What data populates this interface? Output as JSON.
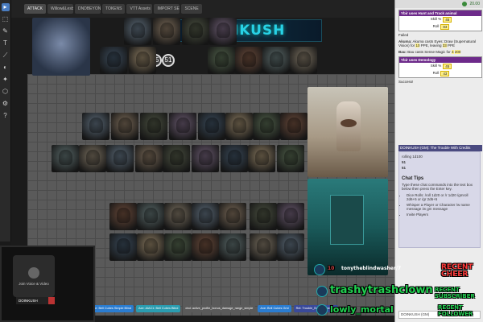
{
  "tabs": [
    "ATTACK",
    "Willow&Lesbians Folder",
    "DNDBEYOND",
    "TOKENS",
    "VTT Assets",
    "IMPORT SETTING",
    "SCENE"
  ],
  "logo_text": "DINKUSH",
  "toolbar_icons": [
    "pointer-icon",
    "select-icon",
    "pen-icon",
    "text-icon",
    "ruler-icon",
    "fog-icon",
    "light-icon",
    "dice-icon",
    "settings-icon",
    "help-icon"
  ],
  "sidebar_top": {
    "status": "20.00"
  },
  "chat": {
    "msg1_header": "Ybir uses Hunt and Track animal",
    "roll1_label": "Skill %",
    "roll1_value": "45",
    "roll1_rolled_label": "Roll",
    "roll1_rolled": "83",
    "roll1_result": "Failed",
    "msg2_name": "Akuma:",
    "msg2_text": "Akuma casts Eyes: Draw (Supernatural Vision) for",
    "msg2_ppe": "10",
    "msg2_ppe_label": "PPE, leaving",
    "msg2_left": "33",
    "msg2_left_label": "PPE",
    "msg3_name": "Bau:",
    "msg3_text": "Bau casts Sense Magic for",
    "msg3_ppe": "4",
    "msg3_left": "200",
    "msg3_header": "Ybir uses Demology",
    "roll2_label": "Skill %",
    "roll2_value": "45",
    "roll2_rolled_label": "Roll",
    "roll2_rolled": "43",
    "roll2_result": "Success!",
    "dark_line": "DOINKUSH (GM): The Trouble With Credits",
    "roll3_label": "rolling 1d100",
    "roll3_value": "51",
    "roll3_total": "51"
  },
  "chat_tips": {
    "title": "Chat Tips",
    "intro": "Type these chat commands into the text box below then press the Enter key.",
    "items": [
      "Dice Rolls: /roll 1d20 or /r 1d20  /gmroll 2d6+5 or /gr 2d6+5",
      "Whisper a Player or Character /w name message  /w gm message",
      "Invite Players"
    ]
  },
  "chat_input": {
    "as_label": "DOINKUSH (GM)"
  },
  "webcam": {
    "join_text": "Join Voice & Video",
    "handle": "DOINKUSH"
  },
  "macros": [
    {
      "label": "Initiative-roll-to-tracker",
      "color": "#c04050"
    },
    {
      "label": "Zug: Sword Of Blade",
      "color": "#8a3aa8"
    },
    {
      "label": "Axe: Bell Cubes Simple Blind",
      "color": "#2a7cd0"
    },
    {
      "label": "Axe: AIAC1: Bell Cubes Blind",
      "color": "#2a9cb0"
    },
    {
      "label": "dnd: active_profile_bonus_damage_range_simple",
      "color": "#5a5a5a"
    },
    {
      "label": "Axe: Bell Cubes Grid",
      "color": "#2a7cd0"
    },
    {
      "label": "Rel: Trouble_Bonus_Damage",
      "color": "#3a4a9a"
    }
  ],
  "overlay": {
    "top_user": "tonytheblindwasher/7",
    "recent_cheer_label": "RECENT CHEER",
    "cheer_user": "trashytrashclown",
    "recent_sub_label": "RECENT SUBSCRIBER",
    "sub_user": "lowly_mortal",
    "recent_follower_label": "RECENT FOLLOWER",
    "cheer_count": "10"
  },
  "tile_colors": [
    "#5b6a78",
    "#7a6a58",
    "#4a5040",
    "#6a5a70",
    "#3a4a5a",
    "#8a7a60",
    "#50604a",
    "#6a4a3a",
    "#5a6a6a",
    "#7a7060"
  ]
}
